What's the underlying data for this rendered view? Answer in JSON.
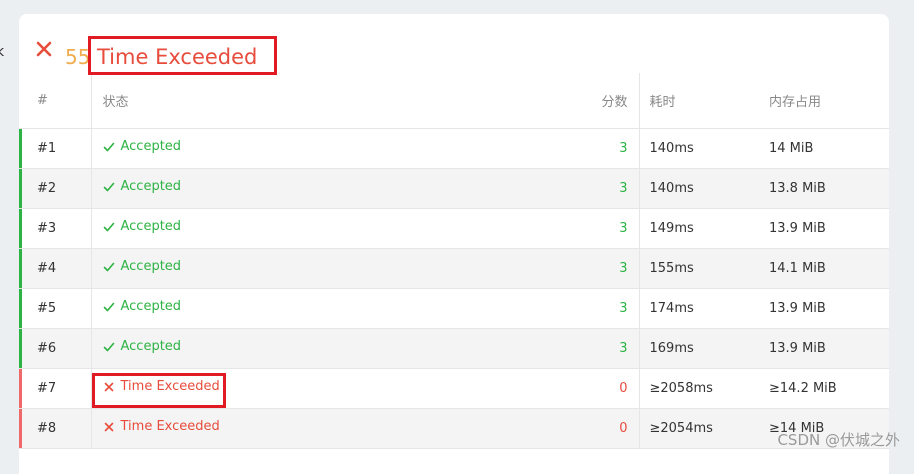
{
  "edge_glyph": "k",
  "header": {
    "score": "55",
    "status": "Time Exceeded",
    "status_icon": "close-icon",
    "colors": {
      "score": "#f0ad4e",
      "status": "#e74c3c"
    }
  },
  "table": {
    "columns": [
      "#",
      "状态",
      "分数",
      "耗时",
      "内存占用"
    ],
    "rows": [
      {
        "num": "#1",
        "status": "Accepted",
        "score": "3",
        "time": "140ms",
        "memory": "14 MiB"
      },
      {
        "num": "#2",
        "status": "Accepted",
        "score": "3",
        "time": "140ms",
        "memory": "13.8 MiB"
      },
      {
        "num": "#3",
        "status": "Accepted",
        "score": "3",
        "time": "149ms",
        "memory": "13.9 MiB"
      },
      {
        "num": "#4",
        "status": "Accepted",
        "score": "3",
        "time": "155ms",
        "memory": "14.1 MiB"
      },
      {
        "num": "#5",
        "status": "Accepted",
        "score": "3",
        "time": "174ms",
        "memory": "13.9 MiB"
      },
      {
        "num": "#6",
        "status": "Accepted",
        "score": "3",
        "time": "169ms",
        "memory": "13.9 MiB"
      },
      {
        "num": "#7",
        "status": "Time Exceeded",
        "score": "0",
        "time": "≥2058ms",
        "memory": "≥14.2 MiB"
      },
      {
        "num": "#8",
        "status": "Time Exceeded",
        "score": "0",
        "time": "≥2054ms",
        "memory": "≥14 MiB"
      }
    ],
    "colors": {
      "accepted": "#2cb344",
      "exceeded": "#e74c3c"
    }
  },
  "watermark": "CSDN @伏城之外"
}
